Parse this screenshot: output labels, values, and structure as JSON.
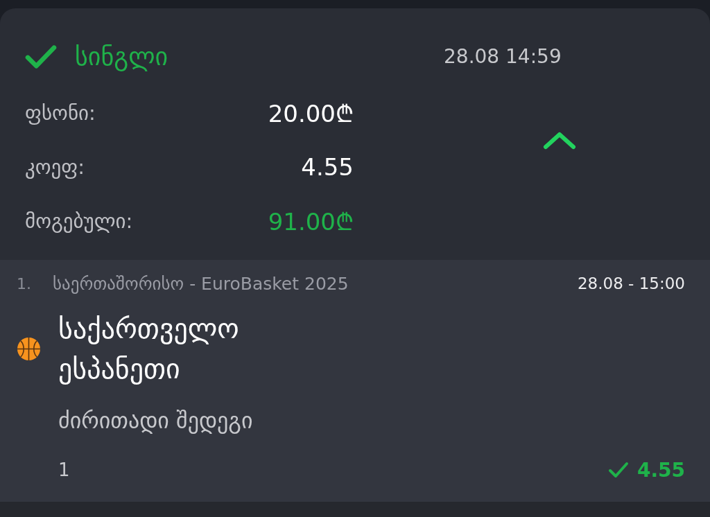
{
  "bet": {
    "won": true,
    "type": "სინგლი",
    "datetime": "28.08 14:59",
    "expanded": true,
    "rows": [
      {
        "label": "ფსონი:",
        "value": "20.00₾",
        "kind": "plain"
      },
      {
        "label": "კოეფ:",
        "value": "4.55",
        "kind": "plain"
      },
      {
        "label": "მოგებული:",
        "value": "91.00₾",
        "kind": "win"
      }
    ]
  },
  "selections": [
    {
      "number": "1.",
      "league": "საერთაშორისო - EuroBasket 2025",
      "datetime": "28.08 - 15:00",
      "teams": [
        "საქართველო",
        "ესპანეთი"
      ],
      "market": "ძირითადი შედეგი",
      "pick": "1",
      "won": true,
      "odds": "4.55"
    }
  ]
}
